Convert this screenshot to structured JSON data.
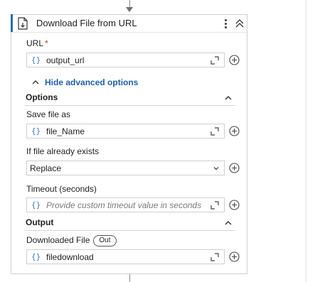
{
  "card": {
    "title": "Download File from URL"
  },
  "fields": {
    "url": {
      "label": "URL",
      "required_mark": "*",
      "value": "output_url"
    },
    "save_file_as": {
      "label": "Save file as",
      "value": "file_Name"
    },
    "if_file_exists": {
      "label": "If file already exists",
      "value": "Replace"
    },
    "timeout": {
      "label": "Timeout (seconds)",
      "placeholder": "Provide custom timeout value in seconds."
    },
    "downloaded_file": {
      "label": "Downloaded File",
      "badge": "Out",
      "value": "filedownload"
    }
  },
  "advanced_toggle": {
    "label": "Hide advanced options"
  },
  "sections": {
    "options": "Options",
    "output": "Output"
  },
  "variable_glyph": "{}",
  "colors": {
    "accent": "#2b6cb0",
    "link": "#1f5fa8",
    "brace": "#3a78c3",
    "required": "#c0392b"
  },
  "icons": [
    "file-download-icon",
    "kebab-menu-icon",
    "collapse-double-chevron-icon",
    "chevron-up-icon",
    "expand-icon",
    "plus-circle-icon",
    "chevron-down-icon"
  ]
}
